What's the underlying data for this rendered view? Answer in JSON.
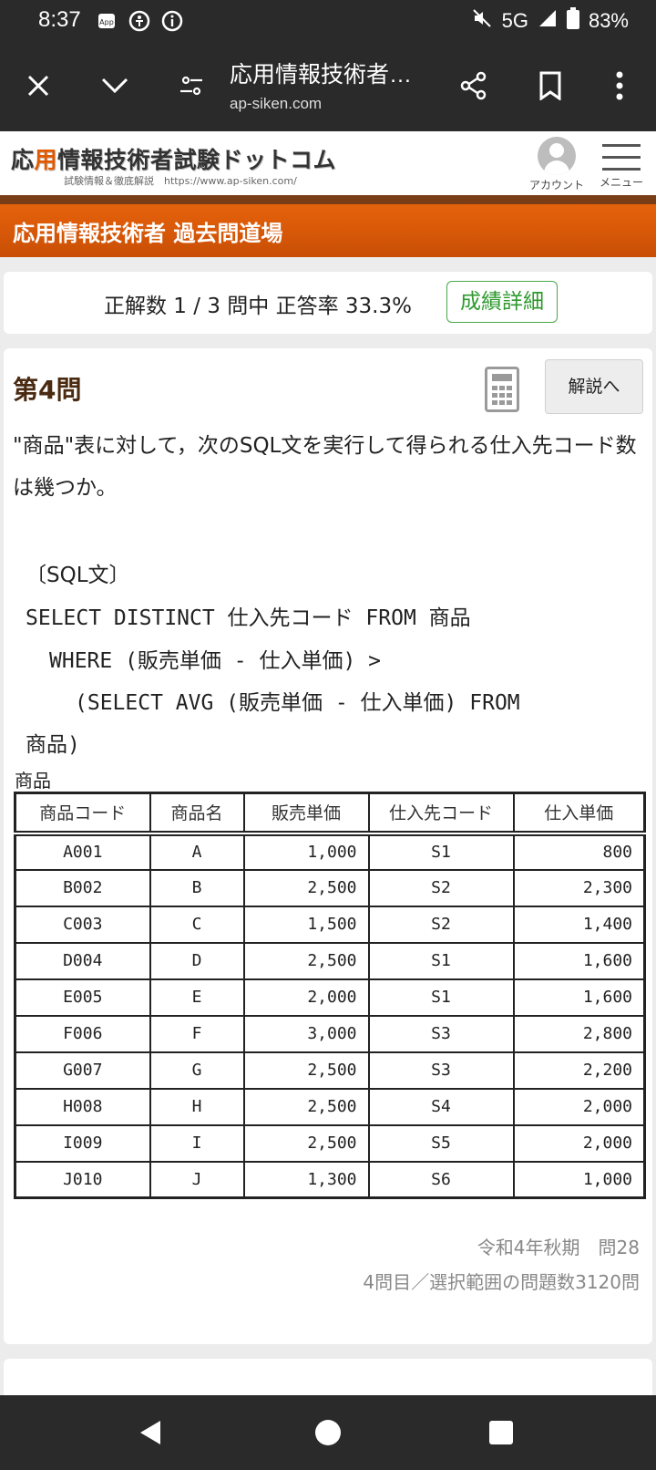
{
  "status_bar": {
    "time": "8:37",
    "network": "5G",
    "battery": "83%",
    "icons": [
      "app-notification-icon",
      "accessibility-icon",
      "info-icon",
      "mute-icon",
      "signal-icon",
      "battery-icon"
    ]
  },
  "browser": {
    "page_title": "応用情報技術者…",
    "url": "ap-siken.com",
    "icons": [
      "close-icon",
      "chevron-down-icon",
      "tune-icon",
      "share-icon",
      "bookmark-icon",
      "more-icon"
    ]
  },
  "site": {
    "logo_accent": "用",
    "logo_pre": "応",
    "logo_post": "情報技術者試験ドットコム",
    "logo_sub": "試験情報＆徹底解説　https://www.ap-siken.com/",
    "account_label": "アカウント",
    "menu_label": "メニュー",
    "banner": "応用情報技術者 過去問道場"
  },
  "score": {
    "text": "正解数 1 / 3 問中 正答率 33.3%",
    "details_button": "成績詳細"
  },
  "question": {
    "number": "第4問",
    "explanation_button": "解説へ",
    "text": "\"商品\"表に対して，次のSQL文を実行して得られる仕入先コード数は幾つか。",
    "sql_heading": "〔SQL文〕",
    "sql_lines": [
      "SELECT DISTINCT 仕入先コード FROM 商品",
      "WHERE (販売単価 - 仕入単価) >",
      "(SELECT AVG (販売単価 - 仕入単価) FROM",
      "商品)"
    ],
    "table_caption": "商品",
    "table": {
      "headers": [
        "商品コード",
        "商品名",
        "販売単価",
        "仕入先コード",
        "仕入単価"
      ],
      "rows": [
        [
          "A001",
          "A",
          "1,000",
          "S1",
          "800"
        ],
        [
          "B002",
          "B",
          "2,500",
          "S2",
          "2,300"
        ],
        [
          "C003",
          "C",
          "1,500",
          "S2",
          "1,400"
        ],
        [
          "D004",
          "D",
          "2,500",
          "S1",
          "1,600"
        ],
        [
          "E005",
          "E",
          "2,000",
          "S1",
          "1,600"
        ],
        [
          "F006",
          "F",
          "3,000",
          "S3",
          "2,800"
        ],
        [
          "G007",
          "G",
          "2,500",
          "S3",
          "2,200"
        ],
        [
          "H008",
          "H",
          "2,500",
          "S4",
          "2,000"
        ],
        [
          "I009",
          "I",
          "2,500",
          "S5",
          "2,000"
        ],
        [
          "J010",
          "J",
          "1,300",
          "S6",
          "1,000"
        ]
      ]
    },
    "source": "令和4年秋期　問28",
    "range": "4問目／選択範囲の問題数3120問"
  },
  "colors": {
    "banner": "#e06008",
    "accent": "#e25a00",
    "details_green": "#2e9a2e",
    "dark_bar": "#2a2a2a"
  }
}
